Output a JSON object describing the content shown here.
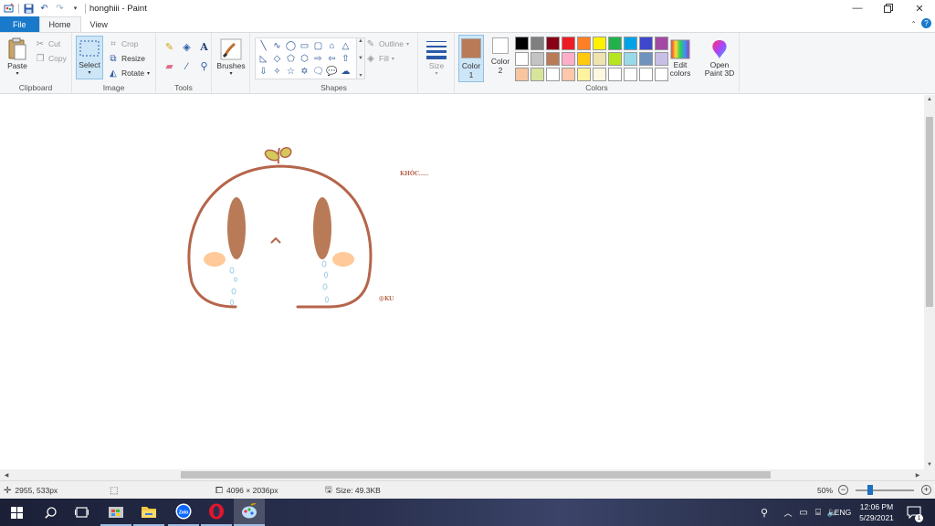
{
  "window": {
    "title": "honghiii - Paint",
    "controls": [
      "minimize",
      "restore",
      "close"
    ]
  },
  "tabs": [
    {
      "label": "File"
    },
    {
      "label": "Home"
    },
    {
      "label": "View"
    }
  ],
  "ribbon": {
    "clipboard": {
      "group_label": "Clipboard",
      "paste": "Paste",
      "cut": "Cut",
      "copy": "Copy"
    },
    "image": {
      "group_label": "Image",
      "select": "Select",
      "crop": "Crop",
      "resize": "Resize",
      "rotate": "Rotate"
    },
    "tools": {
      "group_label": "Tools"
    },
    "brushes": {
      "label": "Brushes"
    },
    "shapes": {
      "group_label": "Shapes",
      "outline": "Outline",
      "fill": "Fill"
    },
    "size": {
      "label": "Size"
    },
    "colors": {
      "group_label": "Colors",
      "color1_label": "Color",
      "color1_num": "1",
      "color1_value": "#b97a57",
      "color2_label": "Color",
      "color2_num": "2",
      "color2_value": "#ffffff",
      "edit_label_1": "Edit",
      "edit_label_2": "colors",
      "palette": [
        "#000000",
        "#7f7f7f",
        "#880015",
        "#ed1c24",
        "#ff7f27",
        "#fff200",
        "#22b14c",
        "#00a2e8",
        "#3f48cc",
        "#a349a4",
        "#ffffff",
        "#c3c3c3",
        "#b97a57",
        "#ffaec9",
        "#ffc90e",
        "#efe4b0",
        "#b5e61d",
        "#99d9ea",
        "#7092be",
        "#c8bfe7",
        "#f7c59f",
        "#d7e59a",
        "#ffffff",
        "#ffc8a8",
        "#fff3a0",
        "#fff8e0",
        "#ffffff",
        "#ffffff",
        "#ffffff",
        "#ffffff"
      ]
    },
    "paint3d": {
      "label_1": "Open",
      "label_2": "Paint 3D"
    }
  },
  "canvas": {
    "text_top": "KHÓC.....",
    "text_signature": "@KU",
    "stroke_color": "#b5654a",
    "eye_color": "#b97a57",
    "blush_color": "#ffc99a",
    "sprout_color": "#d4c95a",
    "tear_color": "#9fd0e8"
  },
  "status": {
    "cursor_position": "2955, 533px",
    "image_size": "4096 × 2036px",
    "file_size": "Size: 49.3KB",
    "zoom": "50%"
  },
  "taskbar": {
    "language": "ENG",
    "time": "12:06 PM",
    "date": "5/29/2021",
    "notification_count": "1"
  }
}
